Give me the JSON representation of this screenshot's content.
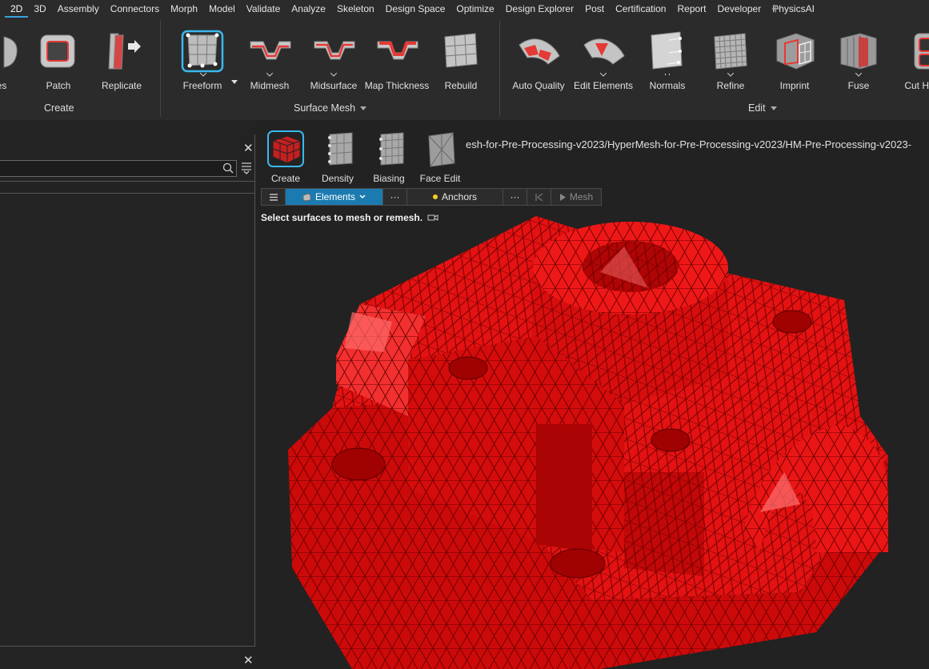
{
  "menubar": {
    "items": [
      "2D",
      "3D",
      "Assembly",
      "Connectors",
      "Morph",
      "Model",
      "Validate",
      "Analyze",
      "Skeleton",
      "Design Space",
      "Optimize",
      "Design Explorer",
      "Post",
      "Certification",
      "Report",
      "Developer",
      "PhysicsAI"
    ],
    "active": "2D"
  },
  "ribbon": {
    "tools": {
      "faces": "ces",
      "patch": "Patch",
      "replicate": "Replicate",
      "freeform": "Freeform",
      "midmesh": "Midmesh",
      "midsurface": "Midsurface",
      "map_thickness": "Map Thickness",
      "rebuild": "Rebuild",
      "auto_quality": "Auto Quality",
      "edit_elements": "Edit Elements",
      "normals": "Normals",
      "refine": "Refine",
      "imprint": "Imprint",
      "fuse": "Fuse",
      "cut_hole": "Cut Ho"
    },
    "groups": {
      "create": "Create",
      "surface_mesh": "Surface Mesh",
      "edit": "Edit"
    }
  },
  "context_tools": {
    "create": "Create",
    "density": "Density",
    "biasing": "Biasing",
    "face_edit": "Face Edit"
  },
  "file_path": "esh-for-Pre-Processing-v2023/HyperMesh-for-Pre-Processing-v2023/HM-Pre-Processing-v2023-",
  "guidebar": {
    "elements_label": "Elements",
    "anchors_label": "Anchors",
    "mesh_label": "Mesh",
    "dots": "···"
  },
  "prompt": "Select surfaces to mesh or remesh.",
  "colors": {
    "accent": "#1b7bb0",
    "mesh_red": "#ee1111",
    "background": "#232323"
  }
}
